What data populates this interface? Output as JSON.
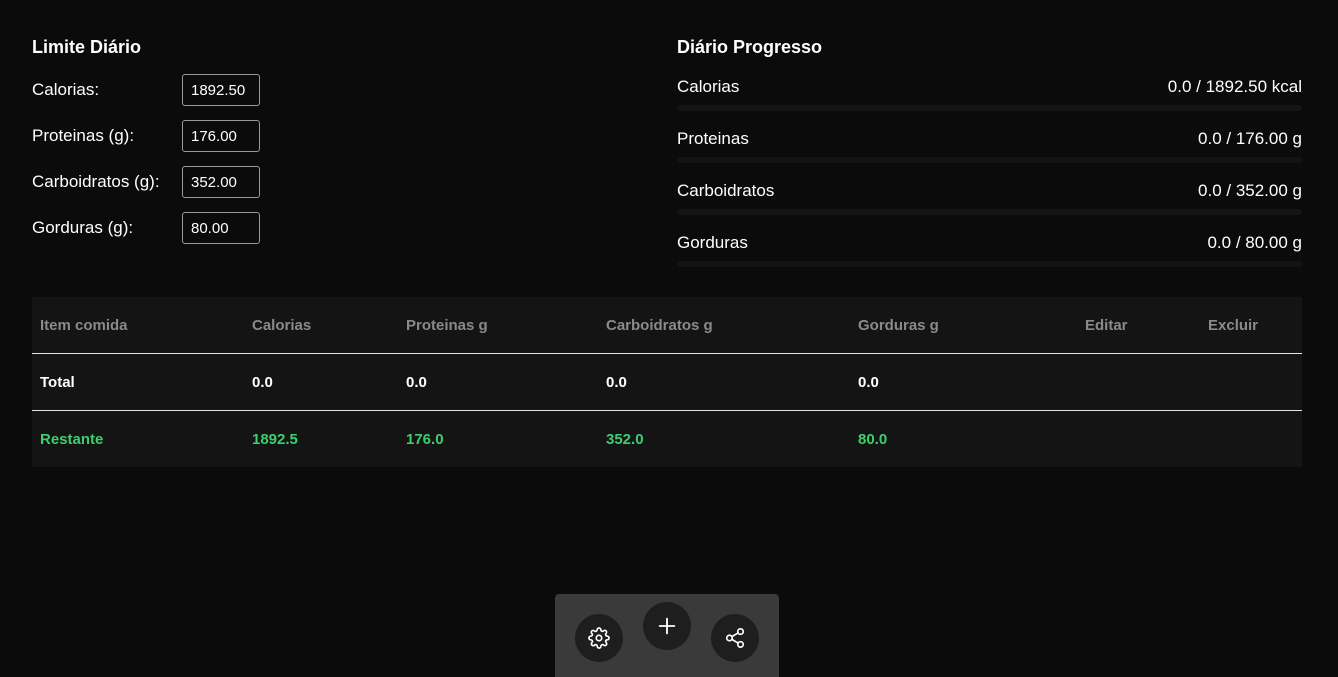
{
  "limits": {
    "title": "Limite Diário",
    "fields": [
      {
        "label": "Calorias:",
        "value": "1892.50"
      },
      {
        "label": "Proteinas (g):",
        "value": "176.00"
      },
      {
        "label": "Carboidratos (g):",
        "value": "352.00"
      },
      {
        "label": "Gorduras (g):",
        "value": "80.00"
      }
    ]
  },
  "progress": {
    "title": "Diário Progresso",
    "items": [
      {
        "label": "Calorias",
        "value": "0.0 / 1892.50 kcal",
        "fraction": 0
      },
      {
        "label": "Proteinas",
        "value": "0.0 / 176.00 g",
        "fraction": 0
      },
      {
        "label": "Carboidratos",
        "value": "0.0 / 352.00 g",
        "fraction": 0
      },
      {
        "label": "Gorduras",
        "value": "0.0 / 80.00 g",
        "fraction": 0
      }
    ]
  },
  "table": {
    "headers": [
      "Item comida",
      "Calorias",
      "Proteinas g",
      "Carboidratos g",
      "Gorduras g",
      "Editar",
      "Excluir"
    ],
    "total": [
      "Total",
      "0.0",
      "0.0",
      "0.0",
      "0.0"
    ],
    "remaining": [
      "Restante",
      "1892.5",
      "176.0",
      "352.0",
      "80.0"
    ]
  },
  "action_bar": {
    "buttons": [
      {
        "name": "settings",
        "icon": "gear-icon"
      },
      {
        "name": "add",
        "icon": "plus-icon"
      },
      {
        "name": "share",
        "icon": "share-icon"
      }
    ]
  },
  "colors": {
    "background": "#0b0b0b",
    "panel": "#141414",
    "accent_green": "#3ccf6e",
    "header_text": "#8a8a8a"
  }
}
